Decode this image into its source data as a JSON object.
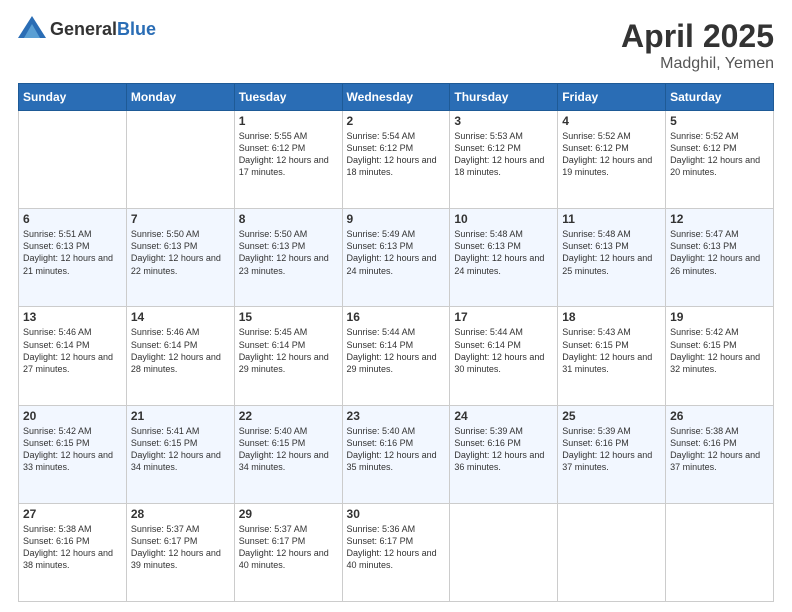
{
  "header": {
    "logo_general": "General",
    "logo_blue": "Blue",
    "title": "April 2025",
    "location": "Madghil, Yemen"
  },
  "days_of_week": [
    "Sunday",
    "Monday",
    "Tuesday",
    "Wednesday",
    "Thursday",
    "Friday",
    "Saturday"
  ],
  "weeks": [
    [
      {
        "day": "",
        "info": ""
      },
      {
        "day": "",
        "info": ""
      },
      {
        "day": "1",
        "info": "Sunrise: 5:55 AM\nSunset: 6:12 PM\nDaylight: 12 hours and 17 minutes."
      },
      {
        "day": "2",
        "info": "Sunrise: 5:54 AM\nSunset: 6:12 PM\nDaylight: 12 hours and 18 minutes."
      },
      {
        "day": "3",
        "info": "Sunrise: 5:53 AM\nSunset: 6:12 PM\nDaylight: 12 hours and 18 minutes."
      },
      {
        "day": "4",
        "info": "Sunrise: 5:52 AM\nSunset: 6:12 PM\nDaylight: 12 hours and 19 minutes."
      },
      {
        "day": "5",
        "info": "Sunrise: 5:52 AM\nSunset: 6:12 PM\nDaylight: 12 hours and 20 minutes."
      }
    ],
    [
      {
        "day": "6",
        "info": "Sunrise: 5:51 AM\nSunset: 6:13 PM\nDaylight: 12 hours and 21 minutes."
      },
      {
        "day": "7",
        "info": "Sunrise: 5:50 AM\nSunset: 6:13 PM\nDaylight: 12 hours and 22 minutes."
      },
      {
        "day": "8",
        "info": "Sunrise: 5:50 AM\nSunset: 6:13 PM\nDaylight: 12 hours and 23 minutes."
      },
      {
        "day": "9",
        "info": "Sunrise: 5:49 AM\nSunset: 6:13 PM\nDaylight: 12 hours and 24 minutes."
      },
      {
        "day": "10",
        "info": "Sunrise: 5:48 AM\nSunset: 6:13 PM\nDaylight: 12 hours and 24 minutes."
      },
      {
        "day": "11",
        "info": "Sunrise: 5:48 AM\nSunset: 6:13 PM\nDaylight: 12 hours and 25 minutes."
      },
      {
        "day": "12",
        "info": "Sunrise: 5:47 AM\nSunset: 6:13 PM\nDaylight: 12 hours and 26 minutes."
      }
    ],
    [
      {
        "day": "13",
        "info": "Sunrise: 5:46 AM\nSunset: 6:14 PM\nDaylight: 12 hours and 27 minutes."
      },
      {
        "day": "14",
        "info": "Sunrise: 5:46 AM\nSunset: 6:14 PM\nDaylight: 12 hours and 28 minutes."
      },
      {
        "day": "15",
        "info": "Sunrise: 5:45 AM\nSunset: 6:14 PM\nDaylight: 12 hours and 29 minutes."
      },
      {
        "day": "16",
        "info": "Sunrise: 5:44 AM\nSunset: 6:14 PM\nDaylight: 12 hours and 29 minutes."
      },
      {
        "day": "17",
        "info": "Sunrise: 5:44 AM\nSunset: 6:14 PM\nDaylight: 12 hours and 30 minutes."
      },
      {
        "day": "18",
        "info": "Sunrise: 5:43 AM\nSunset: 6:15 PM\nDaylight: 12 hours and 31 minutes."
      },
      {
        "day": "19",
        "info": "Sunrise: 5:42 AM\nSunset: 6:15 PM\nDaylight: 12 hours and 32 minutes."
      }
    ],
    [
      {
        "day": "20",
        "info": "Sunrise: 5:42 AM\nSunset: 6:15 PM\nDaylight: 12 hours and 33 minutes."
      },
      {
        "day": "21",
        "info": "Sunrise: 5:41 AM\nSunset: 6:15 PM\nDaylight: 12 hours and 34 minutes."
      },
      {
        "day": "22",
        "info": "Sunrise: 5:40 AM\nSunset: 6:15 PM\nDaylight: 12 hours and 34 minutes."
      },
      {
        "day": "23",
        "info": "Sunrise: 5:40 AM\nSunset: 6:16 PM\nDaylight: 12 hours and 35 minutes."
      },
      {
        "day": "24",
        "info": "Sunrise: 5:39 AM\nSunset: 6:16 PM\nDaylight: 12 hours and 36 minutes."
      },
      {
        "day": "25",
        "info": "Sunrise: 5:39 AM\nSunset: 6:16 PM\nDaylight: 12 hours and 37 minutes."
      },
      {
        "day": "26",
        "info": "Sunrise: 5:38 AM\nSunset: 6:16 PM\nDaylight: 12 hours and 37 minutes."
      }
    ],
    [
      {
        "day": "27",
        "info": "Sunrise: 5:38 AM\nSunset: 6:16 PM\nDaylight: 12 hours and 38 minutes."
      },
      {
        "day": "28",
        "info": "Sunrise: 5:37 AM\nSunset: 6:17 PM\nDaylight: 12 hours and 39 minutes."
      },
      {
        "day": "29",
        "info": "Sunrise: 5:37 AM\nSunset: 6:17 PM\nDaylight: 12 hours and 40 minutes."
      },
      {
        "day": "30",
        "info": "Sunrise: 5:36 AM\nSunset: 6:17 PM\nDaylight: 12 hours and 40 minutes."
      },
      {
        "day": "",
        "info": ""
      },
      {
        "day": "",
        "info": ""
      },
      {
        "day": "",
        "info": ""
      }
    ]
  ]
}
